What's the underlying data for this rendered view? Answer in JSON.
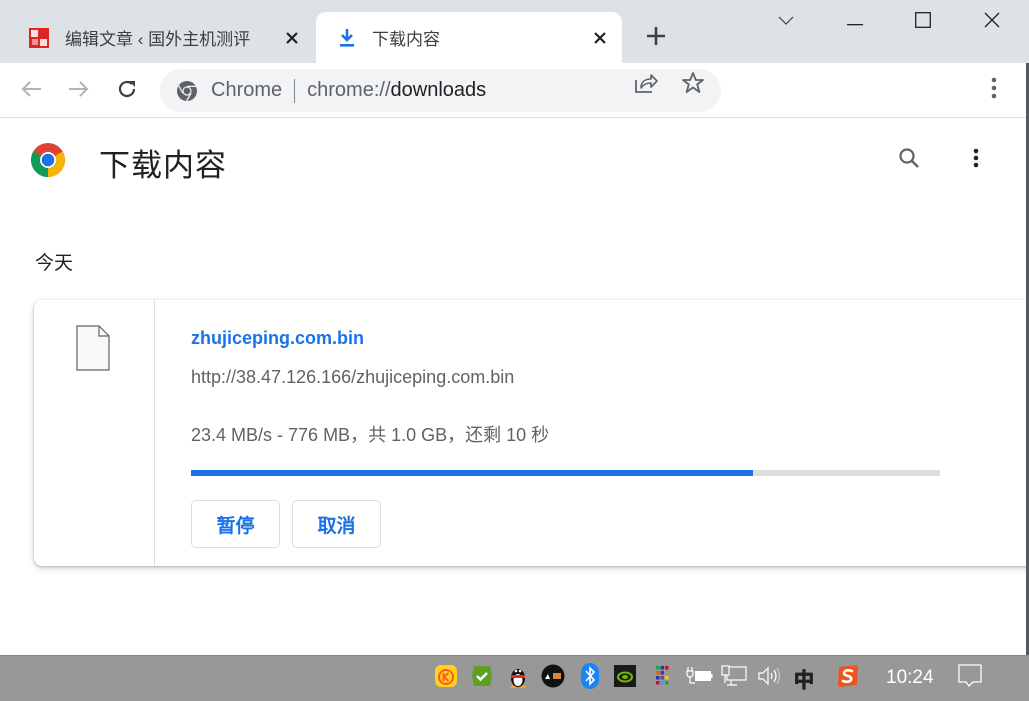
{
  "browser": {
    "tabs": [
      {
        "title": "编辑文章 ‹ 国外主机测评",
        "favicon": "site-seal-icon",
        "active": false
      },
      {
        "title": "下载内容",
        "favicon": "download-icon",
        "active": true
      }
    ],
    "new_tab_icon": "plus-icon",
    "window_controls": [
      "chevron-down-icon",
      "minimize-icon",
      "maximize-icon",
      "close-icon"
    ],
    "nav": {
      "back": "back-arrow-icon",
      "forward": "forward-arrow-icon",
      "reload": "reload-icon"
    },
    "omnibox": {
      "scheme_label": "Chrome",
      "url_prefix": "chrome://",
      "url_host": "downloads",
      "actions": [
        "share-icon",
        "bookmark-star-icon"
      ]
    },
    "menu_icon": "kebab-menu-icon"
  },
  "page": {
    "title": "下载内容",
    "header_actions": [
      "search-icon",
      "more-vert-icon"
    ],
    "date_group": "今天",
    "downloads": [
      {
        "file_name": "zhujiceping.com.bin",
        "url": "http://38.47.126.166/zhujiceping.com.bin",
        "status": "23.4 MB/s - 776 MB，共 1.0 GB，还剩 10 秒",
        "progress_percent": 75,
        "buttons": {
          "pause": "暂停",
          "cancel": "取消"
        }
      }
    ]
  },
  "taskbar": {
    "tray_icons": [
      "kuaishou-app-icon",
      "security-check-icon",
      "qq-penguin-icon",
      "media-app-icon",
      "bluetooth-icon",
      "nvidia-icon",
      "color-grid-app-icon",
      "battery-plug-icon",
      "network-icon",
      "volume-icon",
      "ime-chinese-icon",
      "sogou-input-icon"
    ],
    "ime_label": "中",
    "clock": "10:24",
    "notification_icon": "action-center-icon"
  },
  "colors": {
    "accent": "#1a73e8",
    "tabstrip": "#dee1e6",
    "taskbar": "#989898",
    "progress_track": "#dedede"
  }
}
